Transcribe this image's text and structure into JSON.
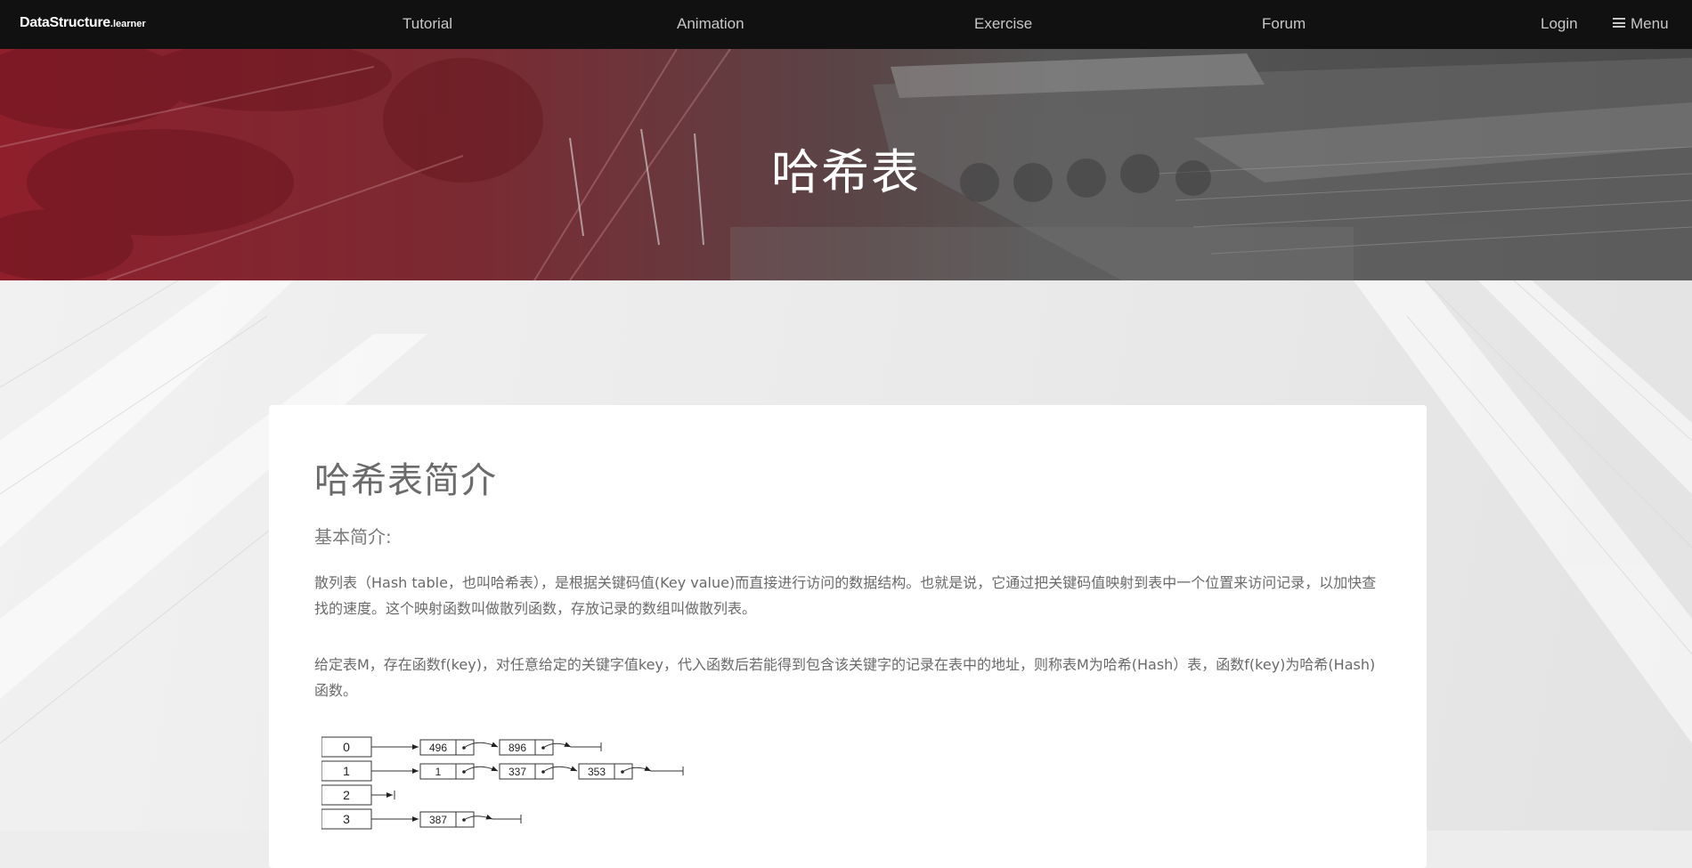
{
  "nav": {
    "brand": "DataStructure",
    "brand_suffix": ".learner",
    "links": [
      "Tutorial",
      "Animation",
      "Exercise",
      "Forum"
    ],
    "login": "Login",
    "menu": "Menu"
  },
  "hero": {
    "title": "哈希表"
  },
  "content": {
    "heading": "哈希表简介",
    "subheading": "基本简介:",
    "paragraph1": "散列表（Hash table，也叫哈希表），是根据关键码值(Key value)而直接进行访问的数据结构。也就是说，它通过把关键码值映射到表中一个位置来访问记录，以加快查找的速度。这个映射函数叫做散列函数，存放记录的数组叫做散列表。",
    "paragraph2": "给定表M，存在函数f(key)，对任意给定的关键字值key，代入函数后若能得到包含该关键字的记录在表中的地址，则称表M为哈希(Hash）表，函数f(key)为哈希(Hash) 函数。"
  },
  "diagram": {
    "buckets": [
      {
        "index": "0",
        "nodes": [
          "496",
          "896"
        ]
      },
      {
        "index": "1",
        "nodes": [
          "1",
          "337",
          "353"
        ]
      },
      {
        "index": "2",
        "nodes": []
      },
      {
        "index": "3",
        "nodes": [
          "387"
        ]
      }
    ]
  },
  "colors": {
    "nav_bg": "#111111",
    "hero_red": "#8e1f2b",
    "text": "#6a6a6a"
  }
}
